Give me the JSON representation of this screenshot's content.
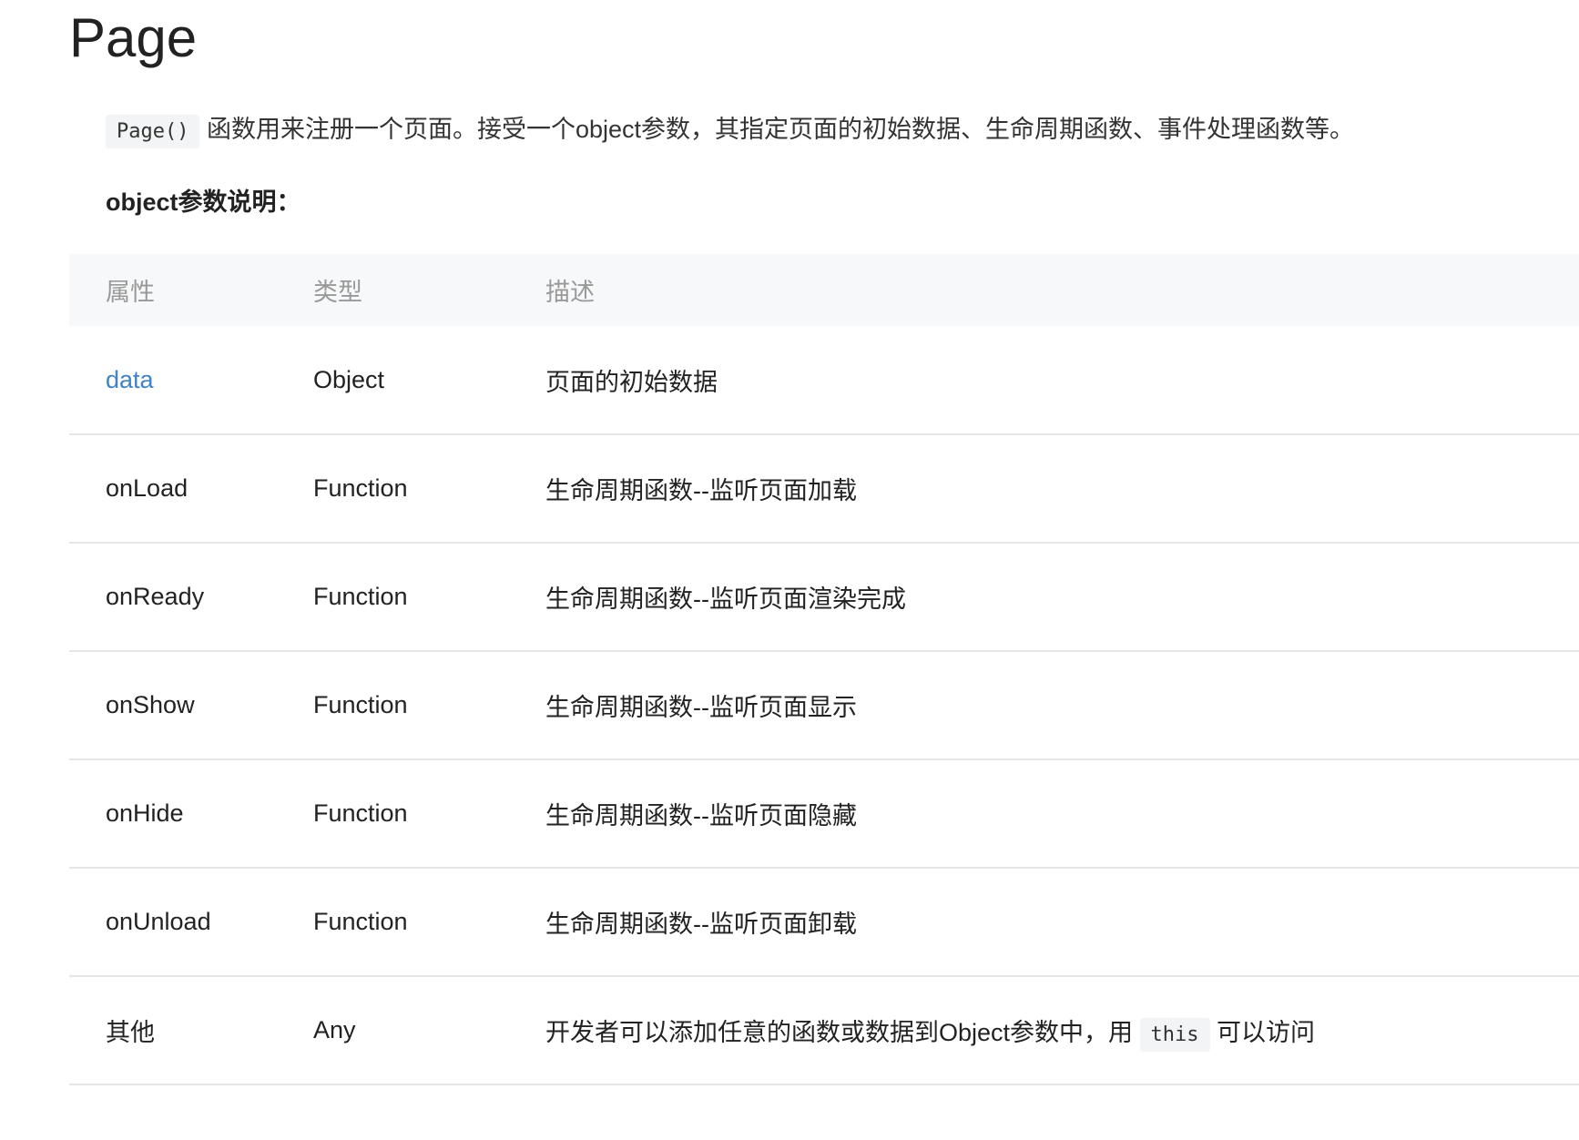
{
  "page": {
    "title": "Page"
  },
  "intro": {
    "code": "Page()",
    "text": " 函数用来注册一个页面。接受一个object参数，其指定页面的初始数据、生命周期函数、事件处理函数等。"
  },
  "section_label": "object参数说明：",
  "table": {
    "headers": [
      "属性",
      "类型",
      "描述"
    ],
    "rows": [
      {
        "name": "data",
        "type": "Object",
        "desc": "页面的初始数据"
      },
      {
        "name": "onLoad",
        "type": "Function",
        "desc": "生命周期函数--监听页面加载"
      },
      {
        "name": "onReady",
        "type": "Function",
        "desc": "生命周期函数--监听页面渲染完成"
      },
      {
        "name": "onShow",
        "type": "Function",
        "desc": "生命周期函数--监听页面显示"
      },
      {
        "name": "onHide",
        "type": "Function",
        "desc": "生命周期函数--监听页面隐藏"
      },
      {
        "name": "onUnload",
        "type": "Function",
        "desc": "生命周期函数--监听页面卸载"
      },
      {
        "name": "其他",
        "type": "Any",
        "desc_before": "开发者可以添加任意的函数或数据到Object参数中，用 ",
        "desc_code": "this",
        "desc_after": " 可以访问"
      }
    ]
  },
  "colors": {
    "link": "#3f83c4",
    "header_bg": "#f7f8f9",
    "header_text": "#999999",
    "row_border": "#e6e6e6",
    "code_bg": "#f3f4f5"
  }
}
